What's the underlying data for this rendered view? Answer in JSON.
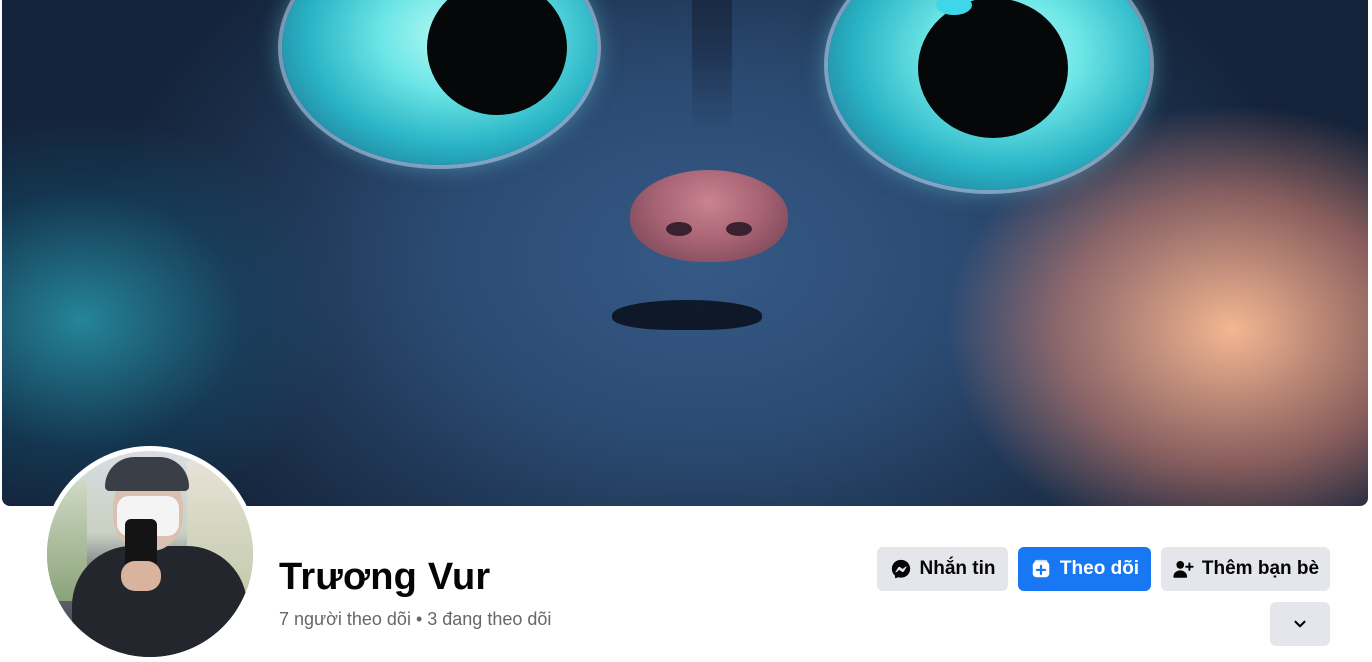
{
  "profile": {
    "name": "Trương Vur",
    "followers": "7 người theo dõi",
    "separator": "•",
    "following": "3 đang theo dõi"
  },
  "actions": {
    "message_label": "Nhắn tin",
    "follow_label": "Theo dõi",
    "add_friend_label": "Thêm bạn bè",
    "more_icon": "chevron-down-icon"
  },
  "icons": {
    "message": "messenger-icon",
    "follow": "follow-icon",
    "add_friend": "add-friend-icon"
  },
  "colors": {
    "primary": "#1877f2",
    "secondary_button": "#e4e6eb",
    "text_primary": "#050505",
    "text_secondary": "#65676b"
  }
}
